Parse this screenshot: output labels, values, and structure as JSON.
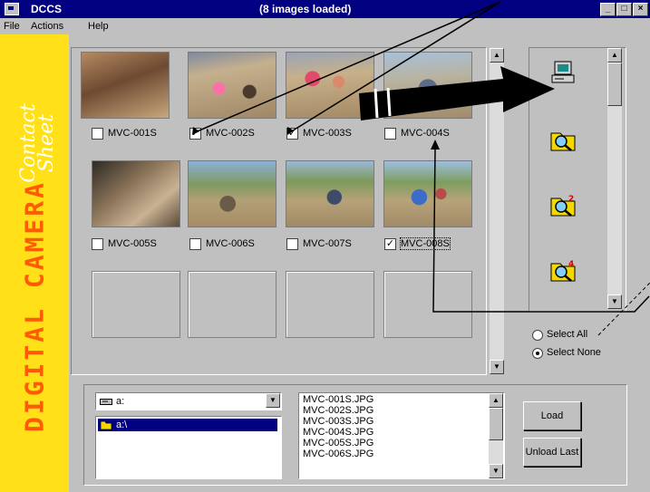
{
  "window": {
    "app_name": "DCCS",
    "status": "(8 images loaded)",
    "controls": [
      "minimize",
      "maximize",
      "close"
    ]
  },
  "menu": [
    "File",
    "Actions",
    "Help"
  ],
  "banner": {
    "title": "DIGITAL CAMERA",
    "subtitle_line1": "Contact",
    "subtitle_line2": "Sheet"
  },
  "thumbnails": [
    {
      "label": "MVC-001S",
      "checked": false
    },
    {
      "label": "MVC-002S",
      "checked": true
    },
    {
      "label": "MVC-003S",
      "checked": true
    },
    {
      "label": "MVC-004S",
      "checked": false
    },
    {
      "label": "MVC-005S",
      "checked": false
    },
    {
      "label": "MVC-006S",
      "checked": false
    },
    {
      "label": "MVC-007S",
      "checked": false
    },
    {
      "label": "MVC-008S",
      "checked": true
    }
  ],
  "checkmark": "✓",
  "actions": {
    "icons": [
      "computer-icon",
      "folder-search-icon",
      "folder-search-2-icon",
      "folder-search-4-icon"
    ],
    "select_all": "Select All",
    "select_none": "Select None",
    "selected": "select_none"
  },
  "browser": {
    "drive": "a:",
    "folder": "a:\\",
    "files": [
      "MVC-001S.JPG",
      "MVC-002S.JPG",
      "MVC-003S.JPG",
      "MVC-004S.JPG",
      "MVC-005S.JPG",
      "MVC-006S.JPG"
    ],
    "load": "Load",
    "unload_last": "Unload Last"
  },
  "colors": {
    "titlebar": "#000080",
    "banner": "#ffe019",
    "banner_text": "#ff5a00",
    "face": "#c0c0c0",
    "selection": "#000080"
  }
}
